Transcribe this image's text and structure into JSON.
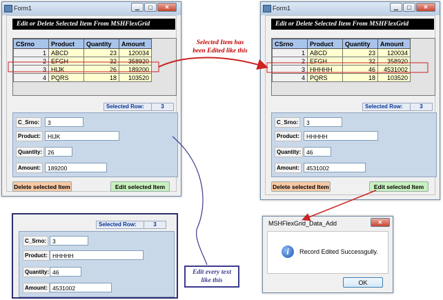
{
  "left_form": {
    "title": "Form1",
    "banner": "Edit or Delete Selected Item From MSHFlexGrid",
    "grid": {
      "headers": [
        "CSrno",
        "Product",
        "Quantity",
        "Amount"
      ],
      "rows": [
        [
          "1",
          "ABCD",
          "23",
          "120034"
        ],
        [
          "2",
          "EFGH",
          "32",
          "358920"
        ],
        [
          "3",
          "HIJK",
          "26",
          "189200"
        ],
        [
          "4",
          "PQRS",
          "18",
          "103520"
        ]
      ]
    },
    "selected_row_label": "Selected Row:",
    "selected_row_value": "3",
    "fields": {
      "c_srno_label": "C_Srno:",
      "c_srno_value": "3",
      "product_label": "Product:",
      "product_value": "HIJK",
      "quantity_label": "Quantity:",
      "quantity_value": "26",
      "amount_label": "Amount:",
      "amount_value": "189200"
    },
    "delete_button": "Delete selected Item",
    "edit_button": "Edit selected Item"
  },
  "right_form": {
    "title": "Form1",
    "banner": "Edit or Delete Selected Item From MSHFlexGrid",
    "grid": {
      "headers": [
        "CSrno",
        "Product",
        "Quantity",
        "Amount"
      ],
      "rows": [
        [
          "1",
          "ABCD",
          "23",
          "120034"
        ],
        [
          "2",
          "EFGH",
          "32",
          "358920"
        ],
        [
          "3",
          "HHHHH",
          "46",
          "4531002"
        ],
        [
          "4",
          "PQRS",
          "18",
          "103520"
        ]
      ]
    },
    "selected_row_label": "Selected Row:",
    "selected_row_value": "3",
    "fields": {
      "c_srno_label": "C_Srno:",
      "c_srno_value": "3",
      "product_label": "Product:",
      "product_value": "HHHHH",
      "quantity_label": "Quantity:",
      "quantity_value": "46",
      "amount_label": "Amount:",
      "amount_value": "4531002"
    },
    "delete_button": "Delete selected Item",
    "edit_button": "Edit selected Item"
  },
  "zoom_panel": {
    "selected_row_label": "Selected Row:",
    "selected_row_value": "3",
    "fields": {
      "c_srno_label": "C_Srno:",
      "c_srno_value": "3",
      "product_label": "Product:",
      "product_value": "HHHHH",
      "quantity_label": "Quantity:",
      "quantity_value": "46",
      "amount_label": "Amount:",
      "amount_value": "4531002"
    }
  },
  "annotations": {
    "edited_note_line1": "Selected Item has",
    "edited_note_line2": "been Edited like this",
    "callout_line1": "Edit every text",
    "callout_line2": "like this"
  },
  "dialog": {
    "title": "MSHFlexGrid_Data_Add",
    "message": "Record Edited Successgully.",
    "ok_button": "OK"
  },
  "colors": {
    "grid_header": "#a9c4eb",
    "grid_cell": "#ffffd0",
    "panel": "#c9d8e9",
    "highlight_arrow": "#cc2222",
    "callout_border": "#3a3a8e",
    "delete_button": "#f7c9a5",
    "edit_button": "#c8f0bf"
  }
}
